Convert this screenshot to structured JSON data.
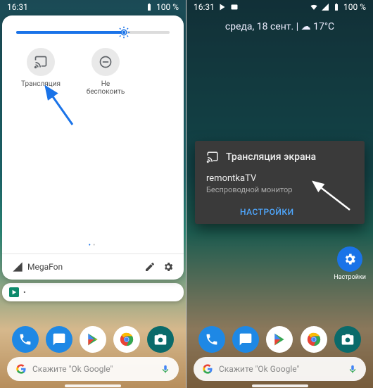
{
  "left": {
    "statusbar": {
      "time": "16:31",
      "battery": "100 %"
    },
    "slider": {
      "value_pct": 70
    },
    "tiles": [
      {
        "name": "cast-tile",
        "icon": "cast-icon",
        "label": "Трансляция"
      },
      {
        "name": "dnd-tile",
        "icon": "dnd-icon",
        "label": "Не беспокоить"
      }
    ],
    "page_indicator": {
      "current": 1,
      "total": 2
    },
    "footer": {
      "carrier": "MegaFon",
      "edit_icon": "pencil-icon",
      "settings_icon": "gear-icon"
    },
    "notification": {
      "app_color": "#0d8a6c",
      "dot": "•"
    },
    "searchbar": {
      "placeholder": "Скажите \"Ok Google\""
    }
  },
  "right": {
    "statusbar": {
      "time": "16:31",
      "battery": "100 %"
    },
    "header": {
      "date": "среда, 18 сент.",
      "sep": "|",
      "weather_icon": "☁",
      "temp": "17°C"
    },
    "dialog": {
      "title": "Трансляция экрана",
      "device": "remontkaTV",
      "subtitle": "Беспроводной монитор",
      "settings_btn": "НАСТРОЙКИ"
    },
    "sidebar_settings_label": "Настройки",
    "searchbar": {
      "placeholder": "Скажите \"Ok Google\""
    }
  },
  "dock_apps": [
    {
      "name": "phone-app",
      "bg": "#1e88e5"
    },
    {
      "name": "messages-app",
      "bg": "#1e88e5"
    },
    {
      "name": "play-store-app",
      "bg": "#ffffff"
    },
    {
      "name": "chrome-app",
      "bg": "#ffffff"
    },
    {
      "name": "camera-app",
      "bg": "#0a6a6a"
    }
  ]
}
